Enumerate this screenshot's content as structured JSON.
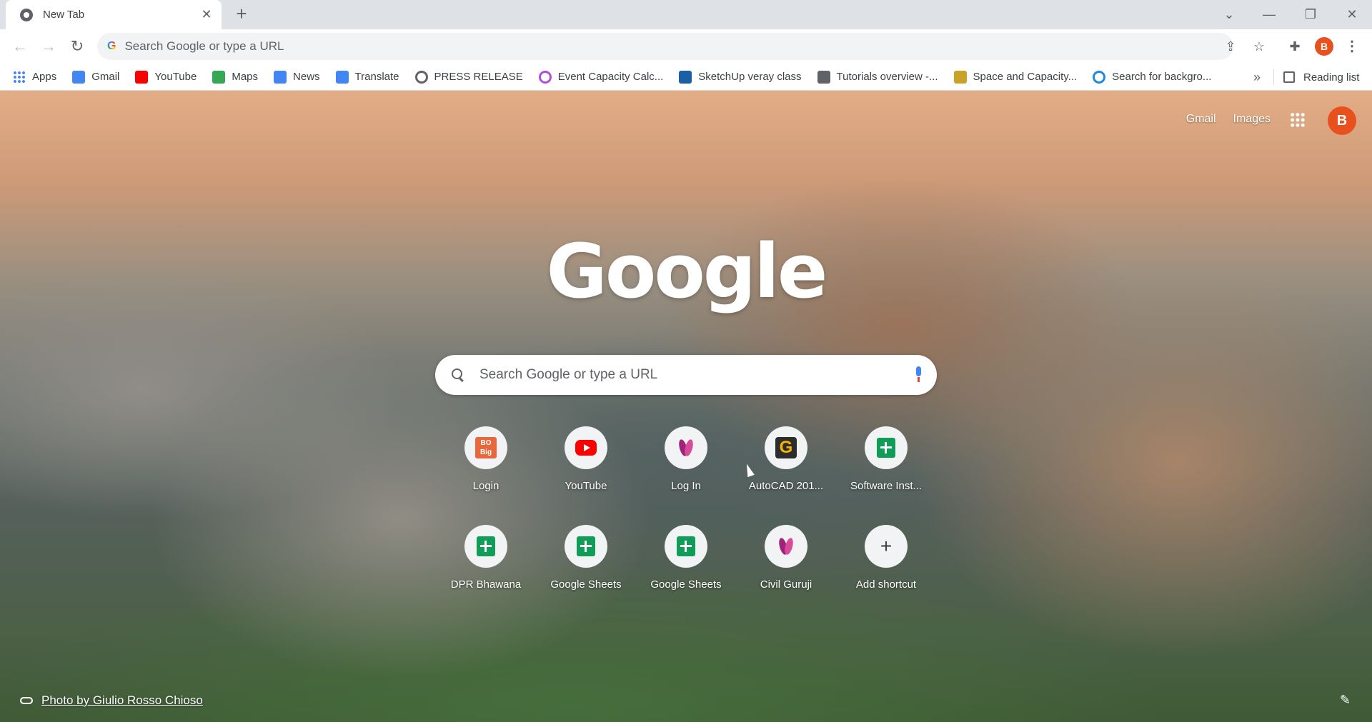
{
  "tab": {
    "title": "New Tab",
    "close": "✕",
    "new": "+"
  },
  "window": {
    "dropdown": "⌄",
    "minimize": "—",
    "restore": "❐",
    "close": "✕"
  },
  "toolbar": {
    "back": "←",
    "forward": "→",
    "reload": "↻",
    "omnibox_placeholder": "Search Google or type a URL",
    "share": "⇪",
    "star": "☆",
    "extensions": "✚",
    "profile_initial": "B",
    "menu": "⋮"
  },
  "bookmarks": {
    "items": [
      {
        "label": "Apps",
        "icon": "apps-grid-icon",
        "color": "#4285f4"
      },
      {
        "label": "Gmail",
        "icon": "google-g-icon",
        "color": "#4285f4"
      },
      {
        "label": "YouTube",
        "icon": "youtube-icon",
        "color": "#ff0000"
      },
      {
        "label": "Maps",
        "icon": "maps-icon",
        "color": "#34a853"
      },
      {
        "label": "News",
        "icon": "news-icon",
        "color": "#4285f4"
      },
      {
        "label": "Translate",
        "icon": "translate-icon",
        "color": "#4285f4"
      },
      {
        "label": "PRESS RELEASE",
        "icon": "globe-icon",
        "color": "#5f6368"
      },
      {
        "label": "Event Capacity Calc...",
        "icon": "sun-icon",
        "color": "#b04fd6"
      },
      {
        "label": "SketchUp veray class",
        "icon": "sketchup-icon",
        "color": "#1b5fa7"
      },
      {
        "label": "Tutorials overview -...",
        "icon": "tutorial-icon",
        "color": "#5f6368"
      },
      {
        "label": "Space and Capacity...",
        "icon": "space-icon",
        "color": "#c9a227"
      },
      {
        "label": "Search for backgro...",
        "icon": "search-bg-icon",
        "color": "#1e88e5"
      }
    ],
    "more": "»",
    "reading_list": "Reading list"
  },
  "ntp": {
    "gmail": "Gmail",
    "images": "Images",
    "avatar_initial": "B",
    "logo": "Google",
    "search_placeholder": "Search Google or type a URL",
    "shortcuts": [
      {
        "label": "Login",
        "icon": "big-icon"
      },
      {
        "label": "YouTube",
        "icon": "youtube-icon"
      },
      {
        "label": "Log In",
        "icon": "civil-guruji-icon"
      },
      {
        "label": "AutoCAD 201...",
        "icon": "autocad-g-icon"
      },
      {
        "label": "Software Inst...",
        "icon": "sheets-icon"
      },
      {
        "label": "DPR Bhawana",
        "icon": "sheets-icon"
      },
      {
        "label": "Google Sheets",
        "icon": "sheets-icon"
      },
      {
        "label": "Google Sheets",
        "icon": "sheets-icon"
      },
      {
        "label": "Civil Guruji",
        "icon": "civil-guruji-icon"
      },
      {
        "label": "Add shortcut",
        "icon": "plus-icon"
      }
    ],
    "photo_credit": "Photo by Giulio Rosso Chioso",
    "big_text": "BO\nBig"
  }
}
